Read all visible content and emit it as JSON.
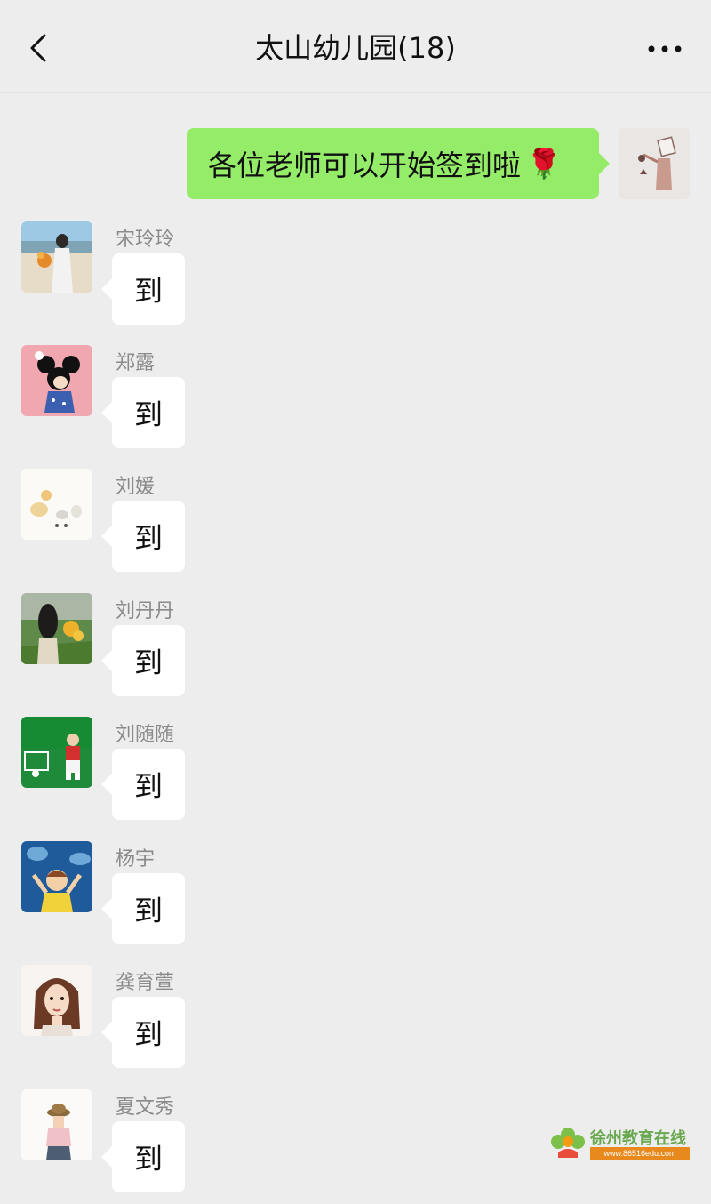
{
  "header": {
    "title": "太山幼儿园(18)",
    "back_icon": "chevron-left-icon",
    "more_icon": "more-horizontal-icon"
  },
  "self_message": {
    "text": "各位老师可以开始签到啦",
    "emoji": "🌹"
  },
  "messages": [
    {
      "sender": "宋玲玲",
      "text": "到"
    },
    {
      "sender": "郑露",
      "text": "到"
    },
    {
      "sender": "刘媛",
      "text": "到"
    },
    {
      "sender": "刘丹丹",
      "text": "到"
    },
    {
      "sender": "刘随随",
      "text": "到"
    },
    {
      "sender": "杨宇",
      "text": "到"
    },
    {
      "sender": "龚育萱",
      "text": "到"
    },
    {
      "sender": "夏文秀",
      "text": "到"
    }
  ],
  "watermark": {
    "name": "徐州教育在线",
    "url": "www.86516edu.com"
  },
  "colors": {
    "background": "#ededed",
    "self_bubble": "#95ec69",
    "other_bubble": "#ffffff",
    "sender_name": "#8a8a8a"
  }
}
